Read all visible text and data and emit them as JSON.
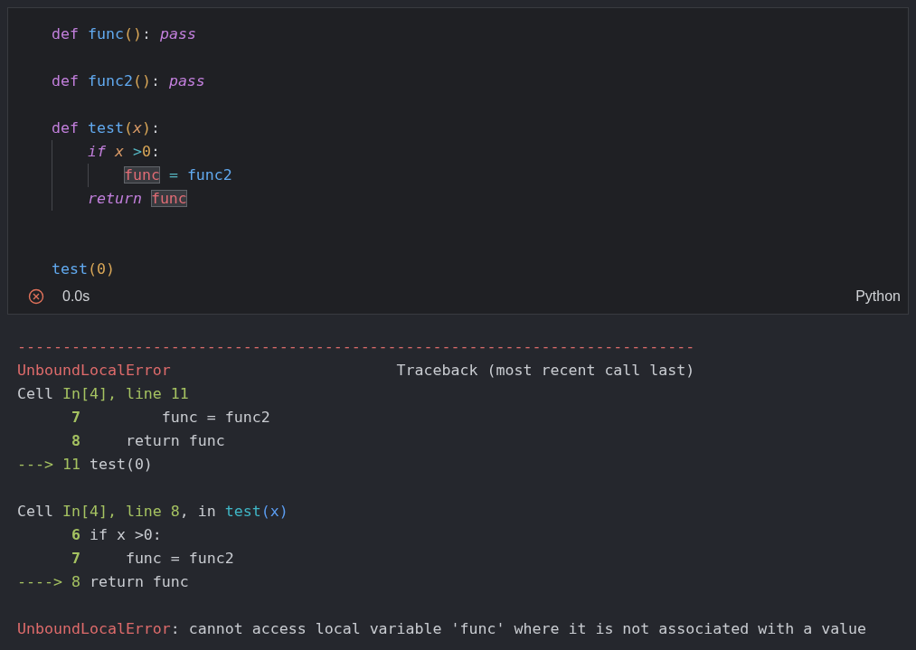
{
  "cell": {
    "code_lines": [
      {
        "kind": "line",
        "tokens": [
          {
            "kind": "keyword",
            "text": "def "
          },
          {
            "kind": "function",
            "text": "func"
          },
          {
            "kind": "paren",
            "text": "()"
          },
          {
            "kind": "plain",
            "text": ": "
          },
          {
            "kind": "italic-keyword",
            "text": "pass"
          }
        ]
      },
      {
        "kind": "blank"
      },
      {
        "kind": "line",
        "tokens": [
          {
            "kind": "keyword",
            "text": "def "
          },
          {
            "kind": "function",
            "text": "func2"
          },
          {
            "kind": "paren",
            "text": "()"
          },
          {
            "kind": "plain",
            "text": ": "
          },
          {
            "kind": "italic-keyword",
            "text": "pass"
          }
        ]
      },
      {
        "kind": "blank"
      },
      {
        "kind": "line",
        "tokens": [
          {
            "kind": "keyword",
            "text": "def "
          },
          {
            "kind": "function",
            "text": "test"
          },
          {
            "kind": "paren",
            "text": "("
          },
          {
            "kind": "param",
            "text": "x"
          },
          {
            "kind": "paren",
            "text": ")"
          },
          {
            "kind": "plain",
            "text": ":"
          }
        ],
        "children": [
          {
            "kind": "line",
            "tokens": [
              {
                "kind": "italic-keyword",
                "text": "if "
              },
              {
                "kind": "param",
                "text": "x "
              },
              {
                "kind": "operator",
                "text": ">"
              },
              {
                "kind": "number",
                "text": "0"
              },
              {
                "kind": "plain",
                "text": ":"
              }
            ],
            "children": [
              {
                "kind": "line",
                "tokens": [
                  {
                    "kind": "highlight",
                    "text": "func"
                  },
                  {
                    "kind": "operator",
                    "text": " = "
                  },
                  {
                    "kind": "function",
                    "text": "func2"
                  }
                ]
              }
            ]
          },
          {
            "kind": "line",
            "tokens": [
              {
                "kind": "italic-keyword",
                "text": "return "
              },
              {
                "kind": "highlight",
                "text": "func"
              }
            ]
          }
        ]
      },
      {
        "kind": "blank"
      },
      {
        "kind": "blank"
      },
      {
        "kind": "line",
        "tokens": [
          {
            "kind": "function",
            "text": "test"
          },
          {
            "kind": "paren",
            "text": "("
          },
          {
            "kind": "number",
            "text": "0"
          },
          {
            "kind": "paren",
            "text": ")"
          }
        ]
      }
    ],
    "status": {
      "kind": "error",
      "duration": "0.0s",
      "language": "Python"
    }
  },
  "output_lines": [
    {
      "kind": "line",
      "tokens": [
        {
          "kind": "error",
          "text": "---------------------------------------------------------------------------"
        }
      ]
    },
    {
      "kind": "line",
      "tokens": [
        {
          "kind": "error",
          "text": "UnboundLocalError"
        },
        {
          "kind": "text",
          "text": "                         Traceback (most recent call last)"
        }
      ]
    },
    {
      "kind": "line",
      "tokens": [
        {
          "kind": "text",
          "text": "Cell "
        },
        {
          "kind": "green",
          "text": "In[4], line 11"
        }
      ]
    },
    {
      "kind": "line",
      "tokens": [
        {
          "kind": "lineno",
          "text": "      7"
        },
        {
          "kind": "text",
          "text": "         func = func2"
        }
      ]
    },
    {
      "kind": "line",
      "tokens": [
        {
          "kind": "lineno",
          "text": "      8"
        },
        {
          "kind": "text",
          "text": "     return func"
        }
      ]
    },
    {
      "kind": "line",
      "tokens": [
        {
          "kind": "green",
          "text": "---> 11"
        },
        {
          "kind": "text",
          "text": " test(0)"
        }
      ]
    },
    {
      "kind": "blank"
    },
    {
      "kind": "line",
      "tokens": [
        {
          "kind": "text",
          "text": "Cell "
        },
        {
          "kind": "green",
          "text": "In[4], line 8"
        },
        {
          "kind": "text",
          "text": ", in "
        },
        {
          "kind": "cyan",
          "text": "test"
        },
        {
          "kind": "blue",
          "text": "(x)"
        }
      ]
    },
    {
      "kind": "line",
      "tokens": [
        {
          "kind": "lineno",
          "text": "      6"
        },
        {
          "kind": "text",
          "text": " if x >0:"
        }
      ]
    },
    {
      "kind": "line",
      "tokens": [
        {
          "kind": "lineno",
          "text": "      7"
        },
        {
          "kind": "text",
          "text": "     func = func2"
        }
      ]
    },
    {
      "kind": "line",
      "tokens": [
        {
          "kind": "green",
          "text": "----> 8"
        },
        {
          "kind": "text",
          "text": " return func"
        }
      ]
    },
    {
      "kind": "blank"
    },
    {
      "kind": "line",
      "tokens": [
        {
          "kind": "error",
          "text": "UnboundLocalError"
        },
        {
          "kind": "text",
          "text": ": cannot access local variable 'func' where it is not associated with a value"
        }
      ]
    }
  ]
}
